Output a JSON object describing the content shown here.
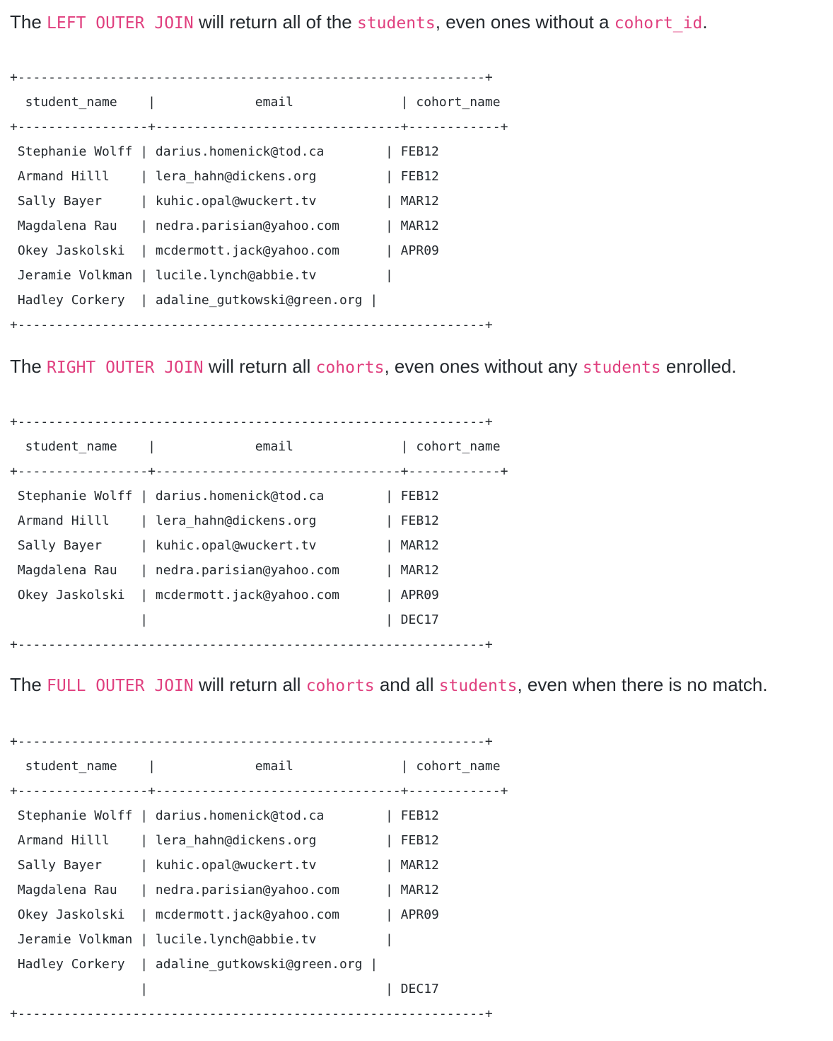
{
  "sections": [
    {
      "sentence": [
        {
          "t": "The ",
          "code": false
        },
        {
          "t": "LEFT OUTER JOIN",
          "code": true
        },
        {
          "t": " will return all of the ",
          "code": false
        },
        {
          "t": "students",
          "code": true
        },
        {
          "t": ", even ones without a ",
          "code": false
        },
        {
          "t": "cohort_id",
          "code": true
        },
        {
          "t": ".",
          "code": false
        }
      ],
      "table_lines": [
        "+-------------------------------------------------------------+",
        "  student_name    |             email              | cohort_name",
        "+-----------------+--------------------------------+------------+",
        " Stephanie Wolff | darius.homenick@tod.ca        | FEB12",
        " Armand Hilll    | lera_hahn@dickens.org         | FEB12",
        " Sally Bayer     | kuhic.opal@wuckert.tv         | MAR12",
        " Magdalena Rau   | nedra.parisian@yahoo.com      | MAR12",
        " Okey Jaskolski  | mcdermott.jack@yahoo.com      | APR09",
        " Jeramie Volkman | lucile.lynch@abbie.tv         |",
        " Hadley Corkery  | adaline_gutkowski@green.org |",
        "+-------------------------------------------------------------+"
      ]
    },
    {
      "sentence": [
        {
          "t": "The ",
          "code": false
        },
        {
          "t": "RIGHT OUTER JOIN",
          "code": true
        },
        {
          "t": " will return all ",
          "code": false
        },
        {
          "t": "cohorts",
          "code": true
        },
        {
          "t": ", even ones without any ",
          "code": false
        },
        {
          "t": "students",
          "code": true
        },
        {
          "t": " enrolled.",
          "code": false
        }
      ],
      "table_lines": [
        "+-------------------------------------------------------------+",
        "  student_name    |             email              | cohort_name",
        "+-----------------+--------------------------------+------------+",
        " Stephanie Wolff | darius.homenick@tod.ca        | FEB12",
        " Armand Hilll    | lera_hahn@dickens.org         | FEB12",
        " Sally Bayer     | kuhic.opal@wuckert.tv         | MAR12",
        " Magdalena Rau   | nedra.parisian@yahoo.com      | MAR12",
        " Okey Jaskolski  | mcdermott.jack@yahoo.com      | APR09",
        "                 |                               | DEC17",
        "+-------------------------------------------------------------+"
      ]
    },
    {
      "sentence": [
        {
          "t": "The ",
          "code": false
        },
        {
          "t": "FULL OUTER JOIN",
          "code": true
        },
        {
          "t": " will return all ",
          "code": false
        },
        {
          "t": "cohorts",
          "code": true
        },
        {
          "t": " and all ",
          "code": false
        },
        {
          "t": "students",
          "code": true
        },
        {
          "t": ", even when there is no match.",
          "code": false
        }
      ],
      "table_lines": [
        "+-------------------------------------------------------------+",
        "  student_name    |             email              | cohort_name",
        "+-----------------+--------------------------------+------------+",
        " Stephanie Wolff | darius.homenick@tod.ca        | FEB12",
        " Armand Hilll    | lera_hahn@dickens.org         | FEB12",
        " Sally Bayer     | kuhic.opal@wuckert.tv         | MAR12",
        " Magdalena Rau   | nedra.parisian@yahoo.com      | MAR12",
        " Okey Jaskolski  | mcdermott.jack@yahoo.com      | APR09",
        " Jeramie Volkman | lucile.lynch@abbie.tv         |",
        " Hadley Corkery  | adaline_gutkowski@green.org |",
        "                 |                               | DEC17",
        "+-------------------------------------------------------------+"
      ]
    }
  ],
  "colors": {
    "text": "#24292e",
    "code": "#e0407f",
    "background": "#ffffff"
  }
}
